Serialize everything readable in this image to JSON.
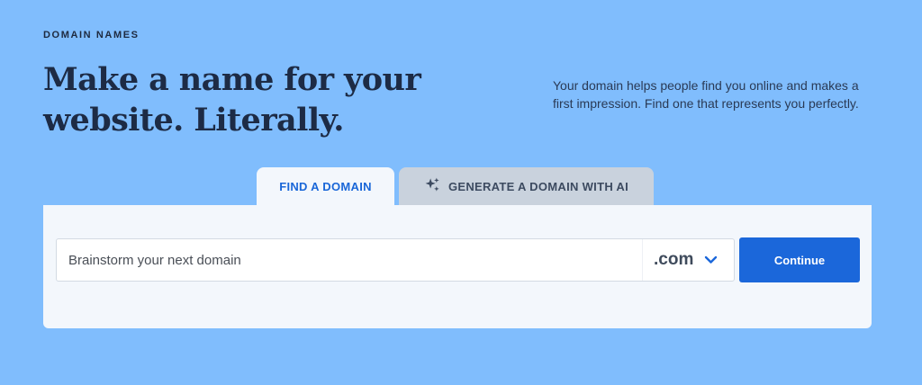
{
  "section": {
    "eyebrow": "DOMAIN NAMES",
    "headline_line1": "Make a name for your",
    "headline_line2": "website. Literally.",
    "blurb": "Your domain helps people find you online and makes a first impression. Find one that represents you perfectly."
  },
  "tabs": [
    {
      "label": "FIND A DOMAIN",
      "active": true
    },
    {
      "label": "GENERATE A DOMAIN WITH AI",
      "active": false,
      "icon": "sparkle-icon"
    }
  ],
  "search": {
    "placeholder": "Brainstorm your next domain",
    "value": "",
    "tld": ".com",
    "tld_icon": "chevron-down-icon",
    "button_label": "Continue"
  },
  "colors": {
    "background": "#80bdfd",
    "accent": "#1b67da",
    "panel": "#f3f7fc",
    "inactive_tab": "#c9d2dd"
  }
}
